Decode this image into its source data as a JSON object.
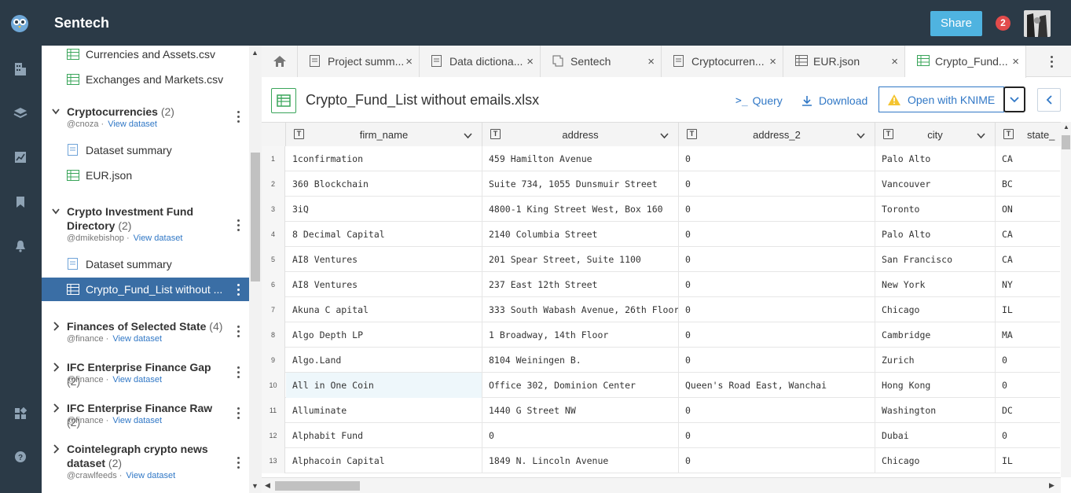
{
  "app": {
    "title": "Sentech",
    "share_label": "Share",
    "notification_count": "2"
  },
  "sidebar": {
    "files_top": [
      {
        "label": "Currencies and Assets.csv"
      },
      {
        "label": "Exchanges and Markets.csv"
      }
    ],
    "datasets": [
      {
        "title": "Cryptocurrencies",
        "count": "(2)",
        "owner": "@cnoza",
        "view": "View dataset",
        "expanded": true,
        "children": [
          {
            "label": "Dataset summary",
            "kind": "doc"
          },
          {
            "label": "EUR.json",
            "kind": "table"
          }
        ]
      },
      {
        "title": "Crypto Investment Fund",
        "title2": "Directory",
        "count": "(2)",
        "owner": "@dmikebishop",
        "view": "View dataset",
        "expanded": true,
        "children": [
          {
            "label": "Dataset summary",
            "kind": "doc"
          },
          {
            "label": "Crypto_Fund_List without ...",
            "kind": "table",
            "selected": true
          }
        ]
      },
      {
        "title": "Finances of Selected State",
        "count": "(4)",
        "owner": "@finance",
        "view": "View dataset"
      },
      {
        "title": "IFC Enterprise Finance Gap",
        "count": "(2)",
        "owner": "@finance",
        "view": "View dataset"
      },
      {
        "title": "IFC Enterprise Finance Raw",
        "count": "(2)",
        "owner": "@finance",
        "view": "View dataset"
      },
      {
        "title": "Cointelegraph crypto news",
        "title2": "dataset",
        "count": "(2)",
        "owner": "@crawlfeeds",
        "view": "View dataset"
      }
    ],
    "sep": "·"
  },
  "tabs": [
    {
      "label": "Project summ...",
      "icon": "doc-icon"
    },
    {
      "label": "Data dictiona...",
      "icon": "doc-icon"
    },
    {
      "label": "Sentech",
      "icon": "project-icon"
    },
    {
      "label": "Cryptocurren...",
      "icon": "doc-icon"
    },
    {
      "label": "EUR.json",
      "icon": "table-icon"
    },
    {
      "label": "Crypto_Fund...",
      "icon": "table-icon",
      "active": true
    }
  ],
  "file": {
    "title": "Crypto_Fund_List without emails.xlsx",
    "query_label": "Query",
    "download_label": "Download",
    "knime_label": "Open with KNIME"
  },
  "table": {
    "columns": [
      "firm_name",
      "address",
      "address_2",
      "city",
      "state_"
    ],
    "type_glyph": "T",
    "rows": [
      [
        "1",
        "1confirmation",
        "459 Hamilton Avenue",
        "0",
        "Palo Alto",
        "CA"
      ],
      [
        "2",
        "360 Blockchain",
        "Suite 734, 1055 Dunsmuir Street",
        "0",
        "Vancouver",
        "BC"
      ],
      [
        "3",
        "3iQ",
        "4800-1 King Street West, Box 160",
        "0",
        "Toronto",
        "ON"
      ],
      [
        "4",
        "8 Decimal Capital",
        "2140 Columbia Street",
        "0",
        "Palo Alto",
        "CA"
      ],
      [
        "5",
        "AI8 Ventures",
        "201 Spear Street, Suite 1100",
        "0",
        "San Francisco",
        "CA"
      ],
      [
        "6",
        "AI8 Ventures",
        "237 East 12th Street",
        "0",
        "New York",
        "NY"
      ],
      [
        "7",
        "Akuna C apital",
        "333 South Wabash Avenue, 26th Floor",
        "0",
        "Chicago",
        "IL"
      ],
      [
        "8",
        "Algo Depth LP",
        "1 Broadway, 14th Floor",
        "0",
        "Cambridge",
        "MA"
      ],
      [
        "9",
        "Algo.Land",
        "8104 Weiningen B.",
        "0",
        "Zurich",
        "0"
      ],
      [
        "10",
        "All in One Coin",
        "Office 302, Dominion Center",
        "Queen's Road East, Wanchai",
        "Hong Kong",
        "0"
      ],
      [
        "11",
        "Alluminate",
        "1440 G Street NW",
        "0",
        "Washington",
        "DC"
      ],
      [
        "12",
        "Alphabit Fund",
        "0",
        "0",
        "Dubai",
        "0"
      ],
      [
        "13",
        "Alphacoin Capital",
        "1849 N. Lincoln Avenue",
        "0",
        "Chicago",
        "IL"
      ]
    ]
  }
}
